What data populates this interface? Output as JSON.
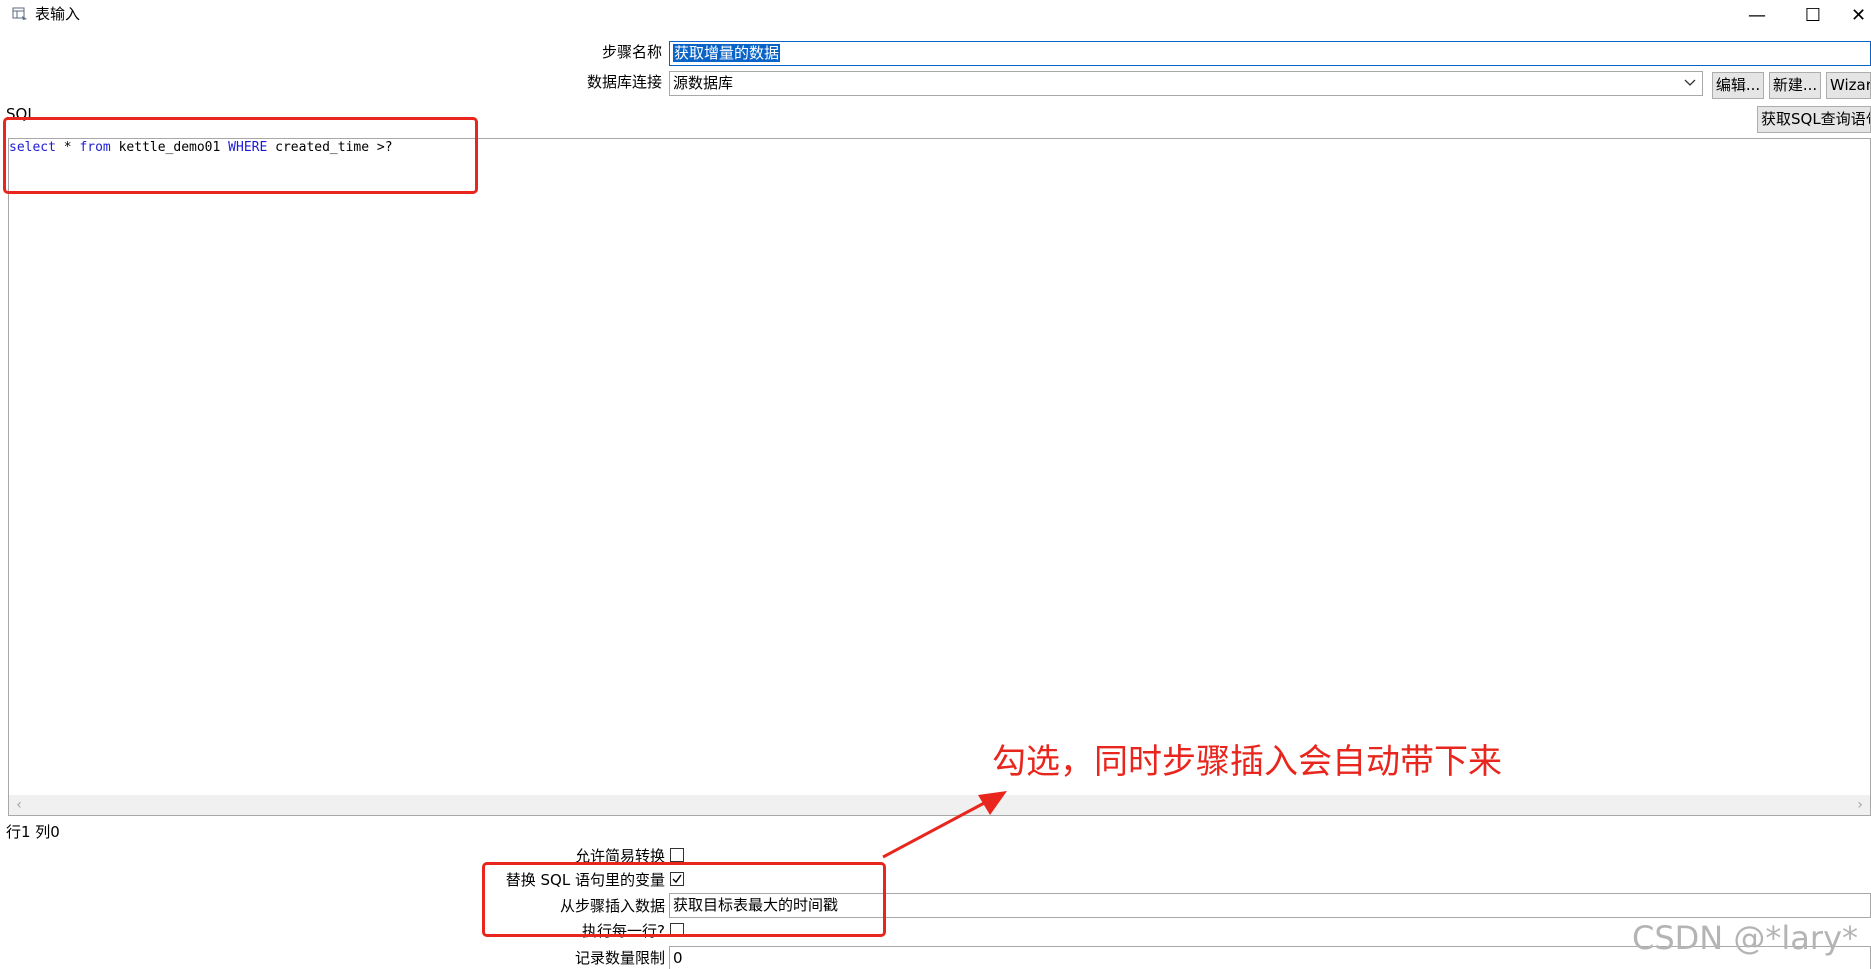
{
  "window": {
    "title": "表输入",
    "minimize_glyph": "—",
    "maximize_glyph": "☐",
    "close_glyph": "✕"
  },
  "form": {
    "step_name_label": "步骤名称",
    "step_name_value": "获取增量的数据",
    "db_conn_label": "数据库连接",
    "db_conn_value": "源数据库",
    "edit_button": "编辑...",
    "new_button": "新建...",
    "wizard_button": "Wizard...",
    "sql_label": "SQL",
    "get_sql_button": "获取SQL查询语句..."
  },
  "sql": {
    "tokens": [
      {
        "text": "select",
        "keyword": true
      },
      {
        "text": " * ",
        "keyword": false
      },
      {
        "text": "from",
        "keyword": true
      },
      {
        "text": " kettle_demo01 ",
        "keyword": false
      },
      {
        "text": "WHERE",
        "keyword": true
      },
      {
        "text": " created_time >?",
        "keyword": false
      }
    ]
  },
  "status": {
    "cursor_position": "行1 列0"
  },
  "options": {
    "lazy_conversion_label": "允许简易转换",
    "lazy_conversion_checked": false,
    "replace_vars_label": "替换 SQL 语句里的变量",
    "replace_vars_checked": true,
    "insert_from_step_label": "从步骤插入数据",
    "insert_from_step_value": "获取目标表最大的时间戳",
    "execute_each_row_label": "执行每一行?",
    "execute_each_row_checked": false,
    "limit_label": "记录数量限制",
    "limit_value": "0"
  },
  "annotation": {
    "text": "勾选，同时步骤插入会自动带下来",
    "color": "#e8261e"
  },
  "watermark": "CSDN @*lary*",
  "colors": {
    "selection": "#0a64c8",
    "keyword": "#1c1cd6",
    "annotation_red": "#e8261e"
  }
}
